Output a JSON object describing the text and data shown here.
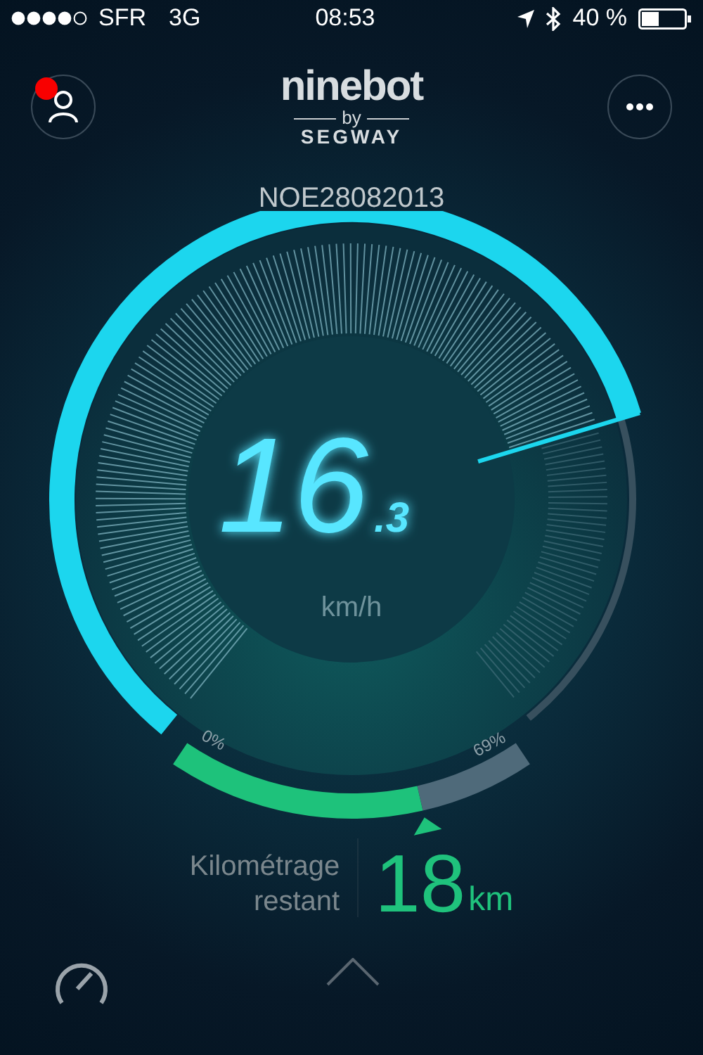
{
  "status_bar": {
    "carrier": "SFR",
    "network": "3G",
    "time": "08:53",
    "battery": "40 %"
  },
  "header": {
    "profile_notification": true,
    "logo": {
      "brand": "ninebot",
      "by": "by",
      "sub": "SEGWAY"
    }
  },
  "device_id": "NOE28082013",
  "speed": {
    "integer": "16",
    "decimal": ".3",
    "unit": "km/h"
  },
  "battery": {
    "start_label": "0%",
    "end_label": "69%"
  },
  "range": {
    "label_line1": "Kilométrage",
    "label_line2": "restant",
    "value": "18",
    "unit": "km"
  }
}
